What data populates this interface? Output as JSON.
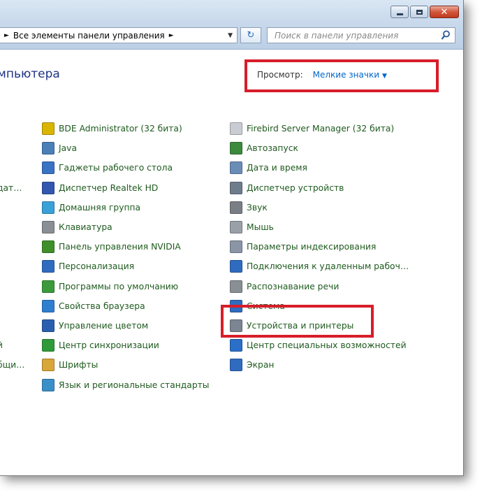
{
  "window": {
    "close_glyph": "✕",
    "minimize_icon": "minimize-icon",
    "maximize_icon": "maximize-icon",
    "close_icon": "close-icon"
  },
  "address_bar": {
    "separator": "►",
    "breadcrumb": "Все элементы панели управления",
    "dropdown_glyph": "▼",
    "refresh_glyph": "↻"
  },
  "search": {
    "placeholder": "Поиск в панели управления"
  },
  "header": {
    "title_fragment": "мпьютера",
    "view_label": "Просмотр:",
    "view_value": "Мелкие значки",
    "view_caret": "▼"
  },
  "partial_items": [
    "дат…",
    "й",
    "бщи…"
  ],
  "items_col1": [
    {
      "label": "BDE Administrator (32 бита)",
      "icon": "bde-icon",
      "color": "#d9b400"
    },
    {
      "label": "Java",
      "icon": "java-icon",
      "color": "#4a7fb8"
    },
    {
      "label": "Гаджеты рабочего стола",
      "icon": "gadgets-icon",
      "color": "#3a72c4"
    },
    {
      "label": "Диспетчер Realtek HD",
      "icon": "realtek-icon",
      "color": "#3157b0"
    },
    {
      "label": "Домашняя группа",
      "icon": "homegroup-icon",
      "color": "#3aa0d8"
    },
    {
      "label": "Клавиатура",
      "icon": "keyboard-icon",
      "color": "#8a8f96"
    },
    {
      "label": "Панель управления NVIDIA",
      "icon": "nvidia-icon",
      "color": "#3f8f2a"
    },
    {
      "label": "Персонализация",
      "icon": "personalization-icon",
      "color": "#2f6cc0"
    },
    {
      "label": "Программы по умолчанию",
      "icon": "default-programs-icon",
      "color": "#3c9a3c"
    },
    {
      "label": "Свойства браузера",
      "icon": "browser-properties-icon",
      "color": "#2f7fd0"
    },
    {
      "label": "Управление цветом",
      "icon": "color-management-icon",
      "color": "#2a5fb0"
    },
    {
      "label": "Центр синхронизации",
      "icon": "sync-center-icon",
      "color": "#2e9a3a"
    },
    {
      "label": "Шрифты",
      "icon": "fonts-icon",
      "color": "#d9a63a"
    },
    {
      "label": "Язык и региональные стандарты",
      "icon": "region-icon",
      "color": "#3a8fc8"
    }
  ],
  "items_col2": [
    {
      "label": "Firebird Server Manager (32 бита)",
      "icon": "firebird-icon",
      "color": "#c9ccd2"
    },
    {
      "label": "Автозапуск",
      "icon": "autoplay-icon",
      "color": "#3c8a3c"
    },
    {
      "label": "Дата и время",
      "icon": "datetime-icon",
      "color": "#6a8db8"
    },
    {
      "label": "Диспетчер устройств",
      "icon": "device-manager-icon",
      "color": "#6f7c8c"
    },
    {
      "label": "Звук",
      "icon": "sound-icon",
      "color": "#7a7f86"
    },
    {
      "label": "Мышь",
      "icon": "mouse-icon",
      "color": "#9aa0a8"
    },
    {
      "label": "Параметры индексирования",
      "icon": "indexing-icon",
      "color": "#8a96a6"
    },
    {
      "label": "Подключения к удаленным рабоч…",
      "icon": "remote-connections-icon",
      "color": "#2f6cc0"
    },
    {
      "label": "Распознавание речи",
      "icon": "speech-icon",
      "color": "#8a8f96"
    },
    {
      "label": "Система",
      "icon": "system-icon",
      "color": "#2f6cc0"
    },
    {
      "label": "Устройства и принтеры",
      "icon": "printer-icon",
      "color": "#7c8592"
    },
    {
      "label": "Центр специальных возможностей",
      "icon": "accessibility-icon",
      "color": "#2a6fc8"
    },
    {
      "label": "Экран",
      "icon": "display-icon",
      "color": "#2f6cc0"
    }
  ]
}
